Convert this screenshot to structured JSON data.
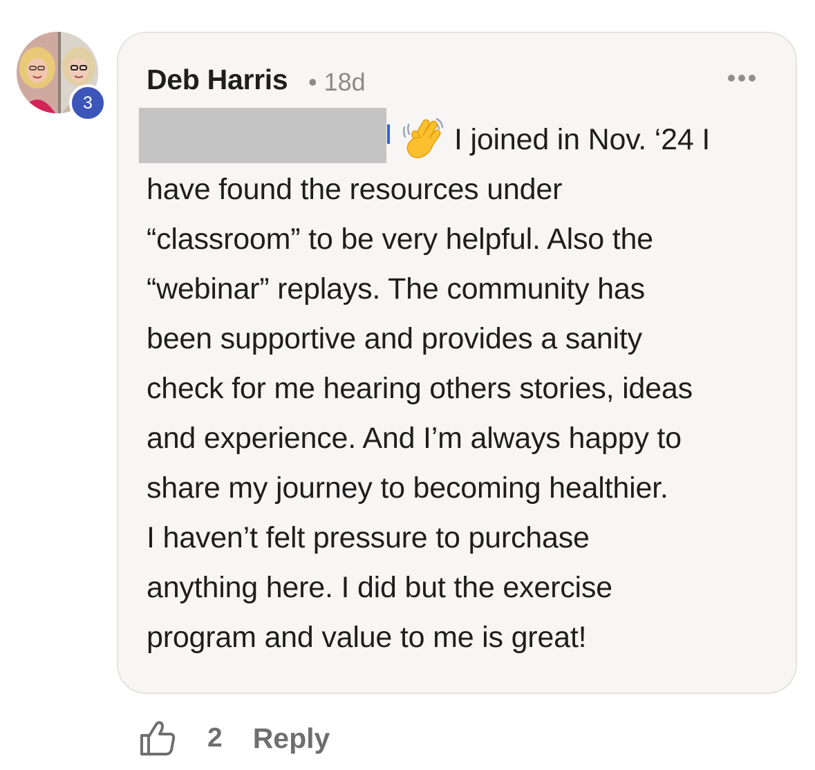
{
  "comment": {
    "author": "Deb Harris",
    "separator": "•",
    "time_ago": "18d",
    "level": "3",
    "more_icon": "ellipsis-icon",
    "body_lines": [
      "I joined in Nov. ‘24 I",
      "have found the resources under",
      "“classroom” to be very helpful. Also the",
      "“webinar” replays. The community has",
      "been supportive and provides a sanity",
      "check for me hearing others stories, ideas",
      "and experience. And I’m always happy to",
      "share my journey to becoming healthier.",
      "I haven’t felt pressure to purchase",
      "anything here. I did but the exercise",
      "program and value to me is great!"
    ],
    "emoji": "waving-hand-icon"
  },
  "actions": {
    "like_icon": "thumbs-up-icon",
    "like_count": "2",
    "reply_label": "Reply"
  },
  "colors": {
    "bubble_background": "#f7f6f5",
    "level_badge": "#3b55b8",
    "mention_link": "#2f63d6",
    "muted_text": "#8a8a8a"
  }
}
